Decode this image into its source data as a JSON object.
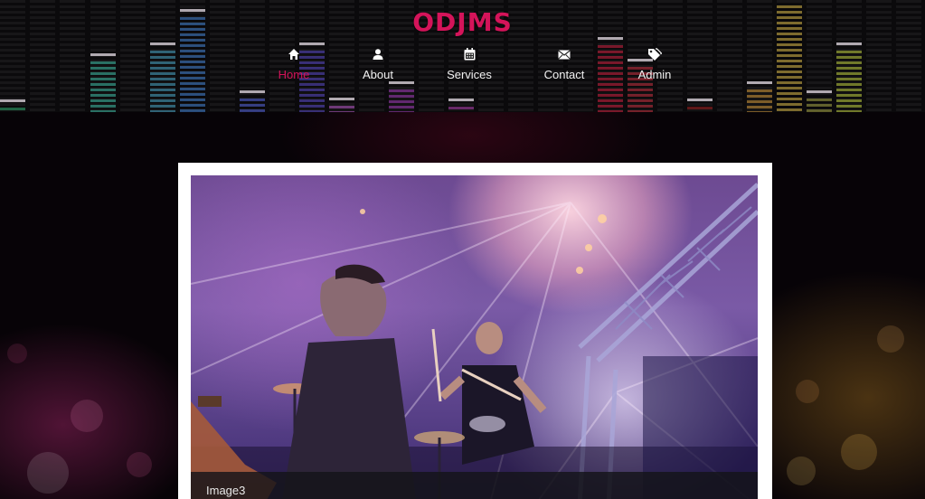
{
  "site": {
    "logo": "ODJMS"
  },
  "nav": {
    "items": [
      {
        "label": "Home",
        "icon": "home-icon",
        "active": true
      },
      {
        "label": "About",
        "icon": "user-icon",
        "active": false
      },
      {
        "label": "Services",
        "icon": "calendar-icon",
        "active": false
      },
      {
        "label": "Contact",
        "icon": "envelope-icon",
        "active": false
      },
      {
        "label": "Admin",
        "icon": "tags-icon",
        "active": false
      }
    ]
  },
  "slider": {
    "caption": "Image3"
  },
  "colors": {
    "accent": "#d4145a",
    "nav_text": "#f2f2f2",
    "frame": "#ffffff"
  }
}
